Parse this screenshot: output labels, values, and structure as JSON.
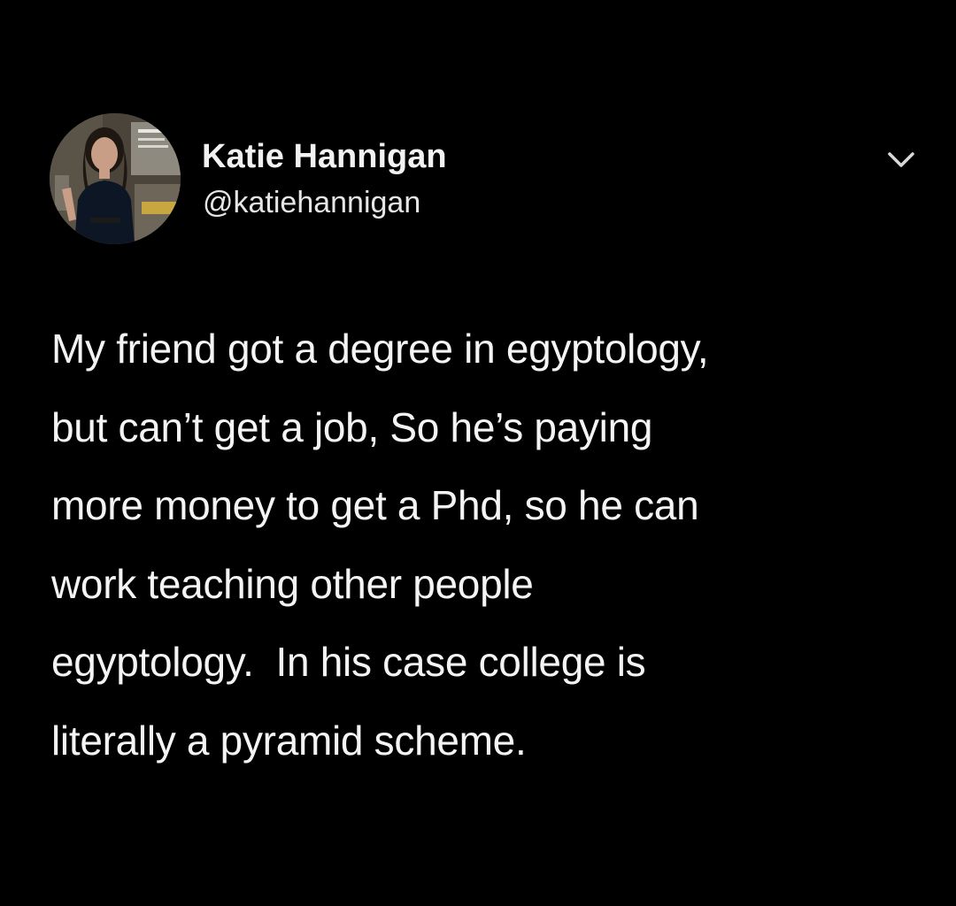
{
  "tweet": {
    "author": {
      "display_name": "Katie Hannigan",
      "handle": "@katiehannigan",
      "avatar_icon": "profile-photo"
    },
    "menu_icon": "chevron-down-icon",
    "text_lines": [
      "My friend got a degree in egyptology,",
      "but can’t get a job, So he’s paying",
      "more money to get a Phd, so he can",
      "work teaching other people",
      "egyptology.  In his case college is",
      "literally a pyramid scheme."
    ]
  },
  "colors": {
    "background": "#000000",
    "text": "#f4f4f4",
    "chevron": "#d9d9d9"
  }
}
